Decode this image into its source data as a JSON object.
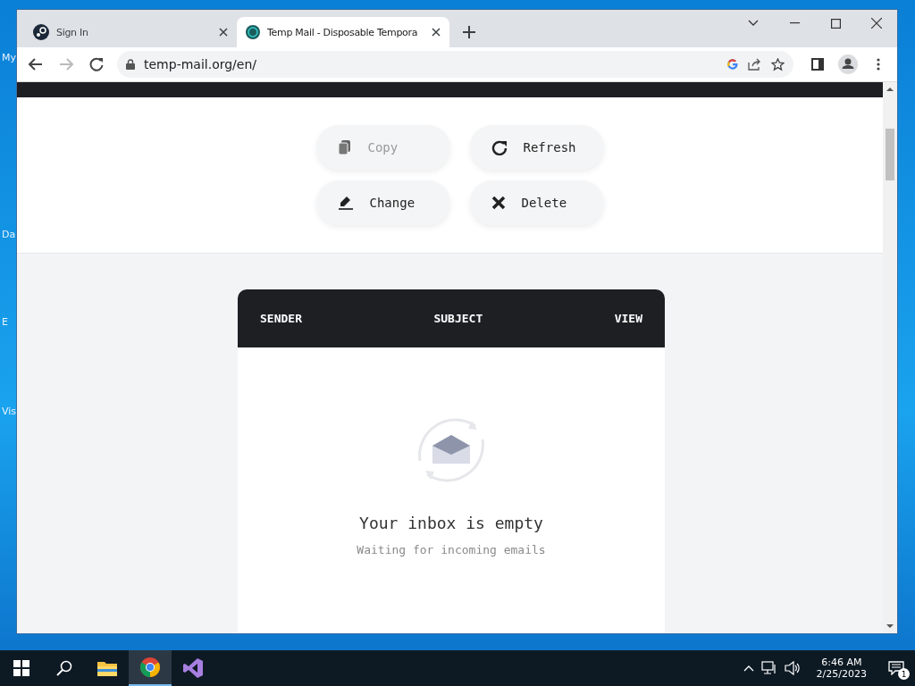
{
  "desktop": {
    "icon_labels": [
      "My",
      "Da",
      "E",
      "Vis"
    ]
  },
  "browser": {
    "tabs": [
      {
        "title": "Sign In",
        "selected": false,
        "kind": "steam"
      },
      {
        "title": "Temp Mail - Disposable Tempora",
        "selected": true,
        "kind": "tempmail"
      }
    ],
    "address": "temp-mail.org/en/"
  },
  "page": {
    "actions": [
      {
        "label": "Copy",
        "kind": "copy",
        "disabled": true
      },
      {
        "label": "Refresh",
        "kind": "refresh",
        "disabled": false
      },
      {
        "label": "Change",
        "kind": "change",
        "disabled": false
      },
      {
        "label": "Delete",
        "kind": "delete",
        "disabled": false
      }
    ],
    "inbox": {
      "columns": [
        "SENDER",
        "SUBJECT",
        "VIEW"
      ],
      "empty_title": "Your inbox is empty",
      "empty_subtitle": "Waiting for incoming emails"
    }
  },
  "taskbar": {
    "apps": [
      {
        "kind": "explorer",
        "active": false
      },
      {
        "kind": "chrome",
        "active": true
      },
      {
        "kind": "studio",
        "active": false
      }
    ],
    "time": "6:46 AM",
    "date": "2/25/2023",
    "notifications": "1"
  }
}
